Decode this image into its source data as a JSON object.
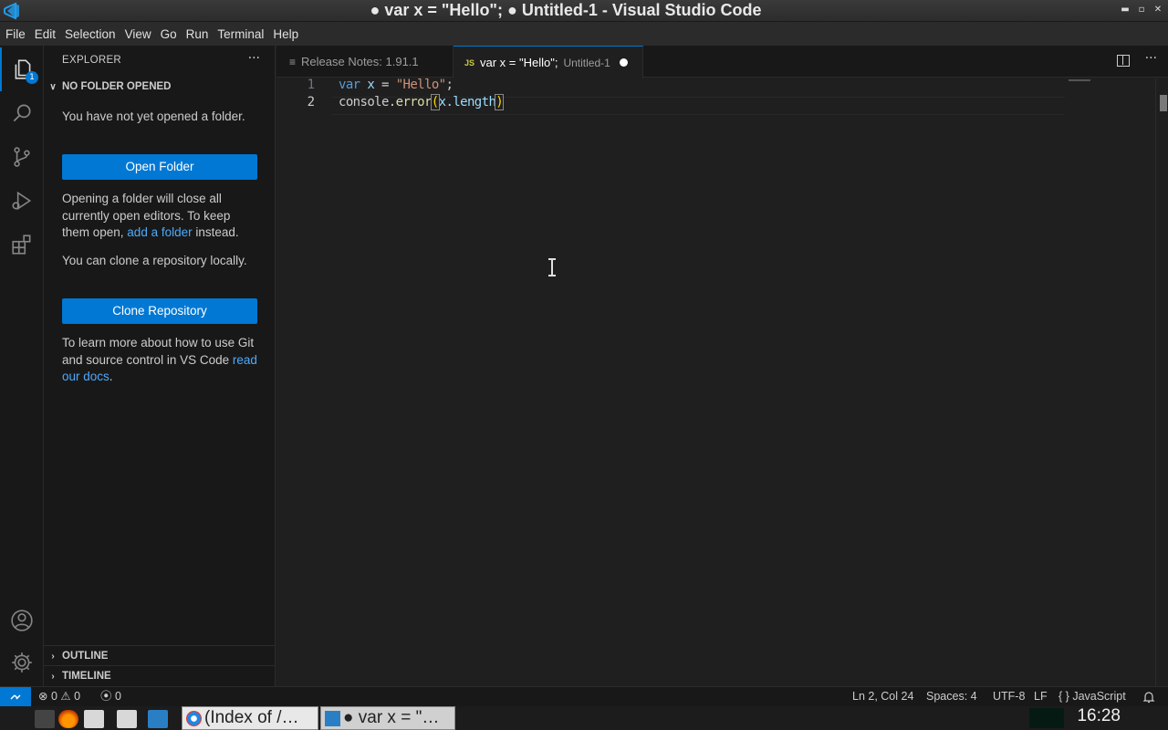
{
  "window": {
    "title": "● var x = \"Hello\"; ● Untitled-1 - Visual Studio Code"
  },
  "menu": [
    "File",
    "Edit",
    "Selection",
    "View",
    "Go",
    "Run",
    "Terminal",
    "Help"
  ],
  "activity": {
    "explorer_badge": "1"
  },
  "sidebar": {
    "header": "EXPLORER",
    "more": "···",
    "section": "NO FOLDER OPENED",
    "no_folder_text": "You have not yet opened a folder.",
    "open_folder_button": "Open Folder",
    "open_info_before": "Opening a folder will close all currently open editors. To keep them open, ",
    "open_info_link": "add a folder",
    "open_info_after": " instead.",
    "clone_text": "You can clone a repository locally.",
    "clone_button": "Clone Repository",
    "git_info_before": "To learn more about how to use Git and source control in VS Code ",
    "git_info_link": "read our docs",
    "git_info_after": ".",
    "outline": "OUTLINE",
    "timeline": "TIMELINE"
  },
  "tabs": [
    {
      "icon": "≡",
      "label": "Release Notes: 1.91.1"
    },
    {
      "icon": "JS",
      "label": "var x = \"Hello\";",
      "desc": "Untitled-1"
    }
  ],
  "editor": {
    "lines": [
      {
        "no": "1",
        "tokens": [
          [
            "kw",
            "var"
          ],
          [
            "plain",
            " "
          ],
          [
            "var",
            "x"
          ],
          [
            "plain",
            " = "
          ],
          [
            "str",
            "\"Hello\""
          ],
          [
            "plain",
            ";"
          ]
        ]
      },
      {
        "no": "2",
        "tokens": [
          [
            "plain",
            "console."
          ],
          [
            "fn",
            "error"
          ],
          [
            "br",
            "("
          ],
          [
            "prop",
            "x.length"
          ],
          [
            "br",
            ")"
          ]
        ]
      }
    ]
  },
  "status": {
    "errors": "0",
    "warnings": "0",
    "ports": "0",
    "position": "Ln 2, Col 24",
    "spaces": "Spaces: 4",
    "encoding": "UTF-8",
    "eol": "LF",
    "language_icon": "{ }",
    "language": "JavaScript"
  },
  "taskbar": {
    "tasks": [
      "(Index of /…",
      "● var x = \"…"
    ],
    "clock": "16:28"
  }
}
